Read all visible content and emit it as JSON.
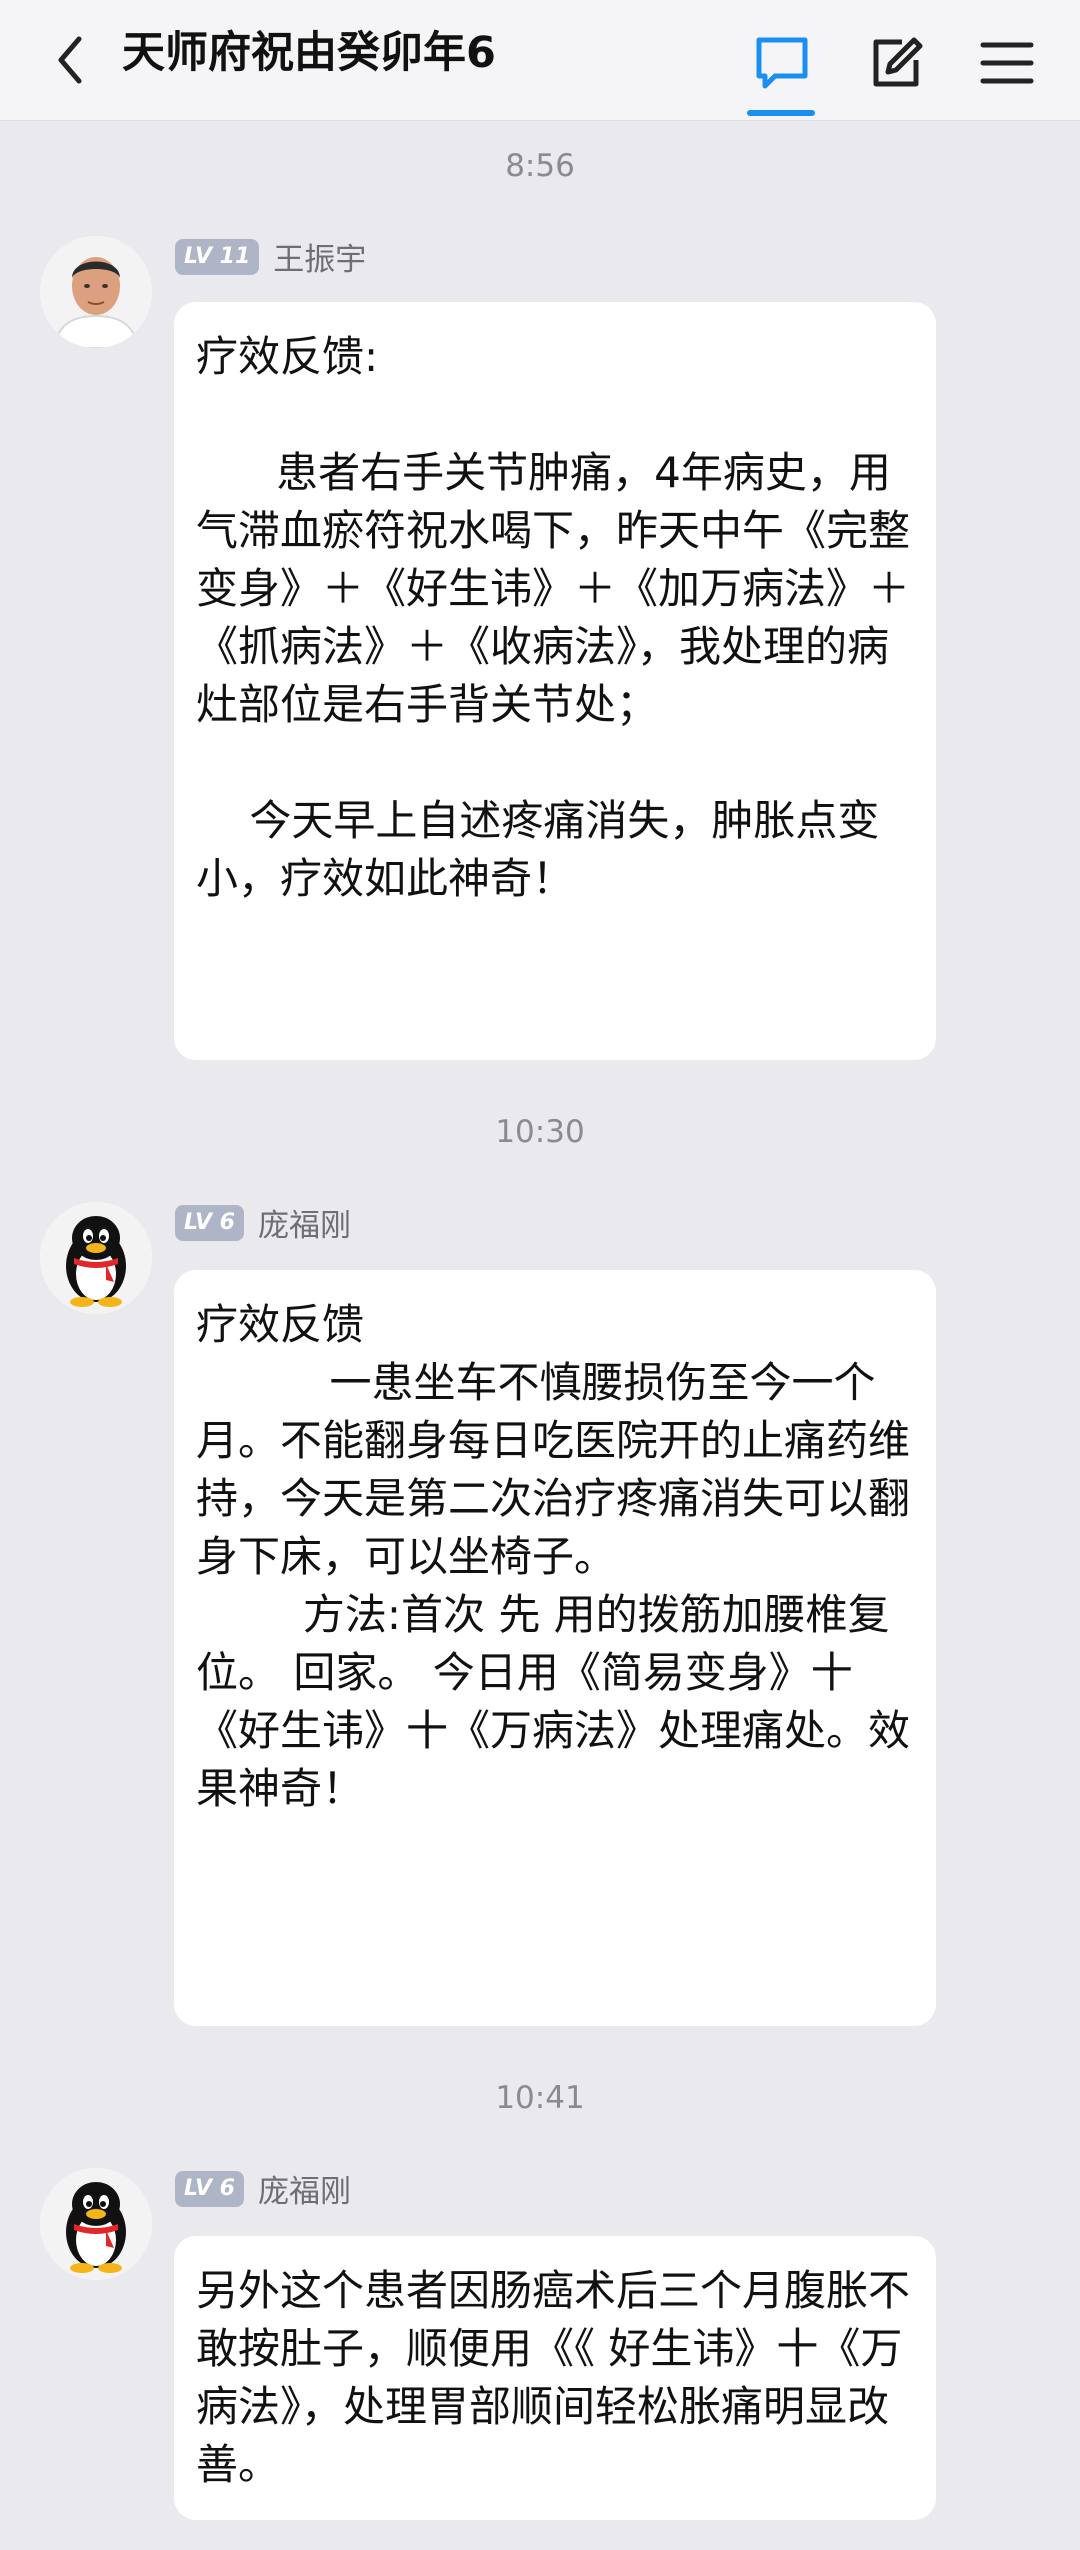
{
  "header": {
    "title": "天师府祝由癸卯年6",
    "icons": [
      "back-chevron-icon",
      "chat-bubble-icon",
      "edit-icon",
      "menu-icon"
    ],
    "accent_color": "#1b8ef2"
  },
  "messages": [
    {
      "time": "8:56",
      "level": "LV 11",
      "sender": "王振宇",
      "text": "疗效反馈:\n\n      患者右手关节肿痛，4年病史，用气滞血瘀符祝水喝下，昨天中午《完整变身》＋《好生讳》＋《加万病法》＋《抓病法》＋《收病法》，我处理的病灶部位是右手背关节处；\n\n    今天早上自述疼痛消失，肿胀点变小，疗效如此神奇！"
    },
    {
      "time": "10:30",
      "level": "LV 6",
      "sender": "庞福刚",
      "text": "疗效反馈\n          一患坐车不慎腰损伤至今一个月。不能翻身每日吃医院开的止痛药维持，今天是第二次治疗疼痛消失可以翻身下床，可以坐椅子。\n        方法:首次 先 用的拨筋加腰椎复位。 回家。 今日用《简易变身》十《好生讳》十《万病法》处理痛处。效果神奇！"
    },
    {
      "time": "10:41",
      "level": "LV 6",
      "sender": "庞福刚",
      "text": "另外这个患者因肠癌术后三个月腹胀不敢按肚子，顺便用《《 好生讳》十《万病法》，处理胃部顺间轻松胀痛明显改善。"
    }
  ]
}
